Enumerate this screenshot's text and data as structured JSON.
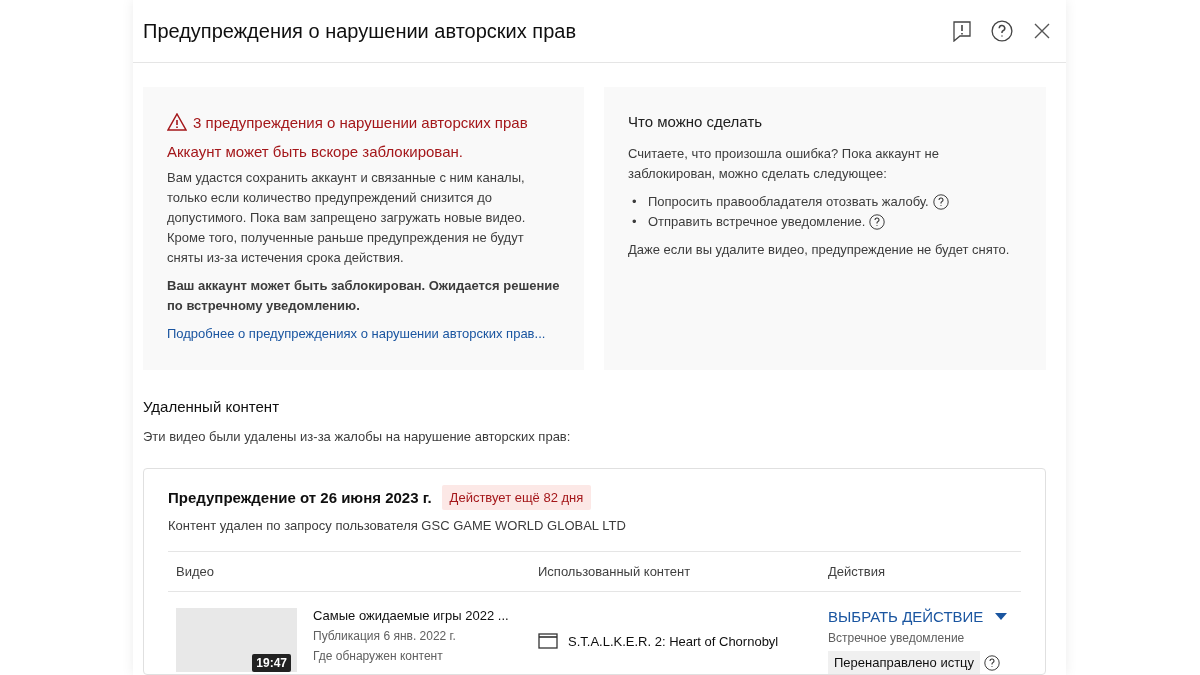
{
  "dialog": {
    "title": "Предупреждения о нарушении авторских прав"
  },
  "warning_card": {
    "heading": "3 предупреждения о нарушении авторских прав",
    "subheading": "Аккаунт может быть вскоре заблокирован.",
    "body": "Вам удастся сохранить аккаунт и связанные с ним каналы, только если количество предупреждений снизится до допустимого. Пока вам запрещено загружать новые видео. Кроме того, полученные раньше предупреждения не будут сняты из-за истечения срока действия.",
    "status": "Ваш аккаунт может быть заблокирован. Ожидается решение по встречному уведомлению.",
    "link": "Подробнее о предупреждениях о нарушении авторских прав..."
  },
  "help_card": {
    "heading": "Что можно сделать",
    "intro": "Считаете, что произошла ошибка? Пока аккаунт не заблокирован, можно сделать следующее:",
    "options": [
      {
        "bullet": "•",
        "text": "Попросить правообладателя отозвать жалобу."
      },
      {
        "bullet": "•",
        "text": "Отправить встречное уведомление."
      }
    ],
    "note": "Даже если вы удалите видео, предупреждение не будет снято."
  },
  "removed": {
    "heading": "Удаленный контент",
    "description": "Эти видео были удалены из-за жалобы на нарушение авторских прав:"
  },
  "strike": {
    "title": "Предупреждение от 26 июня 2023 г.",
    "badge": "Действует ещё 82 дня",
    "requester": "Контент удален по запросу пользователя GSC GAME WORLD GLOBAL LTD",
    "columns": [
      "Видео",
      "Использованный контент",
      "Действия"
    ],
    "rows": [
      {
        "duration": "19:47",
        "video_title": "Самые ожидаемые игры 2022 ...",
        "published": "Публикация 6 янв. 2022 г.",
        "found_label": "Где обнаружен контент",
        "content": "S.T.A.L.K.E.R. 2: Heart of Chornobyl",
        "action": "ВЫБРАТЬ ДЕЙСТВИЕ",
        "action_label": "Встречное уведомление",
        "action_status": "Перенаправлено истцу"
      }
    ]
  }
}
